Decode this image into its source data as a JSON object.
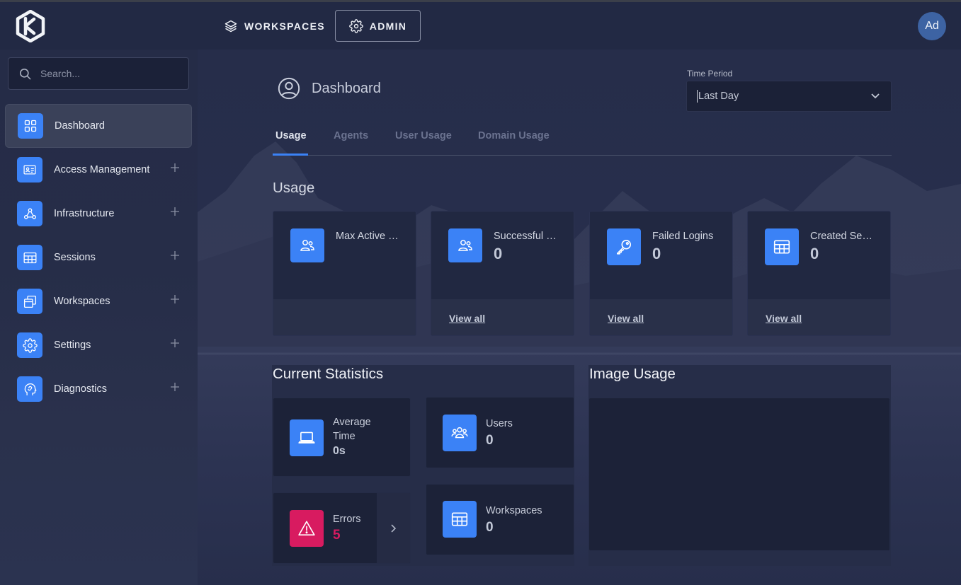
{
  "topbar": {
    "workspaces_label": "WORKSPACES",
    "admin_label": "ADMIN",
    "avatar_initials": "Ad"
  },
  "sidebar": {
    "search_placeholder": "Search...",
    "items": [
      {
        "label": "Dashboard",
        "icon": "grid-icon",
        "active": true,
        "expandable": false
      },
      {
        "label": "Access Management",
        "icon": "id-card-icon",
        "active": false,
        "expandable": true
      },
      {
        "label": "Infrastructure",
        "icon": "webhook-icon",
        "active": false,
        "expandable": true
      },
      {
        "label": "Sessions",
        "icon": "table-icon",
        "active": false,
        "expandable": true
      },
      {
        "label": "Workspaces",
        "icon": "windows-icon",
        "active": false,
        "expandable": true
      },
      {
        "label": "Settings",
        "icon": "gear-icon",
        "active": false,
        "expandable": true
      },
      {
        "label": "Diagnostics",
        "icon": "brain-head-icon",
        "active": false,
        "expandable": true
      }
    ]
  },
  "header": {
    "title": "Dashboard",
    "time_period_label": "Time Period",
    "time_period_value": "Last Day"
  },
  "tabs": [
    "Usage",
    "Agents",
    "User Usage",
    "Domain Usage"
  ],
  "usage": {
    "title": "Usage",
    "cards": [
      {
        "label": "Max Active …",
        "value": "",
        "link": "",
        "icon": "users-icon"
      },
      {
        "label": "Successful …",
        "value": "0",
        "link": "View all",
        "icon": "users-icon"
      },
      {
        "label": "Failed Logins",
        "value": "0",
        "link": "View all",
        "icon": "key-icon"
      },
      {
        "label": "Created Se…",
        "value": "0",
        "link": "View all",
        "icon": "table-icon"
      }
    ]
  },
  "current_statistics": {
    "title": "Current Statistics",
    "average_time": {
      "label_line1": "Average",
      "label_line2": "Time",
      "value": "0s"
    },
    "users": {
      "label": "Users",
      "value": "0"
    },
    "errors": {
      "label": "Errors",
      "value": "5"
    },
    "workspaces": {
      "label": "Workspaces",
      "value": "0"
    }
  },
  "image_usage": {
    "title": "Image Usage"
  },
  "colors": {
    "accent": "#3b82f6",
    "error": "#d81b60"
  }
}
